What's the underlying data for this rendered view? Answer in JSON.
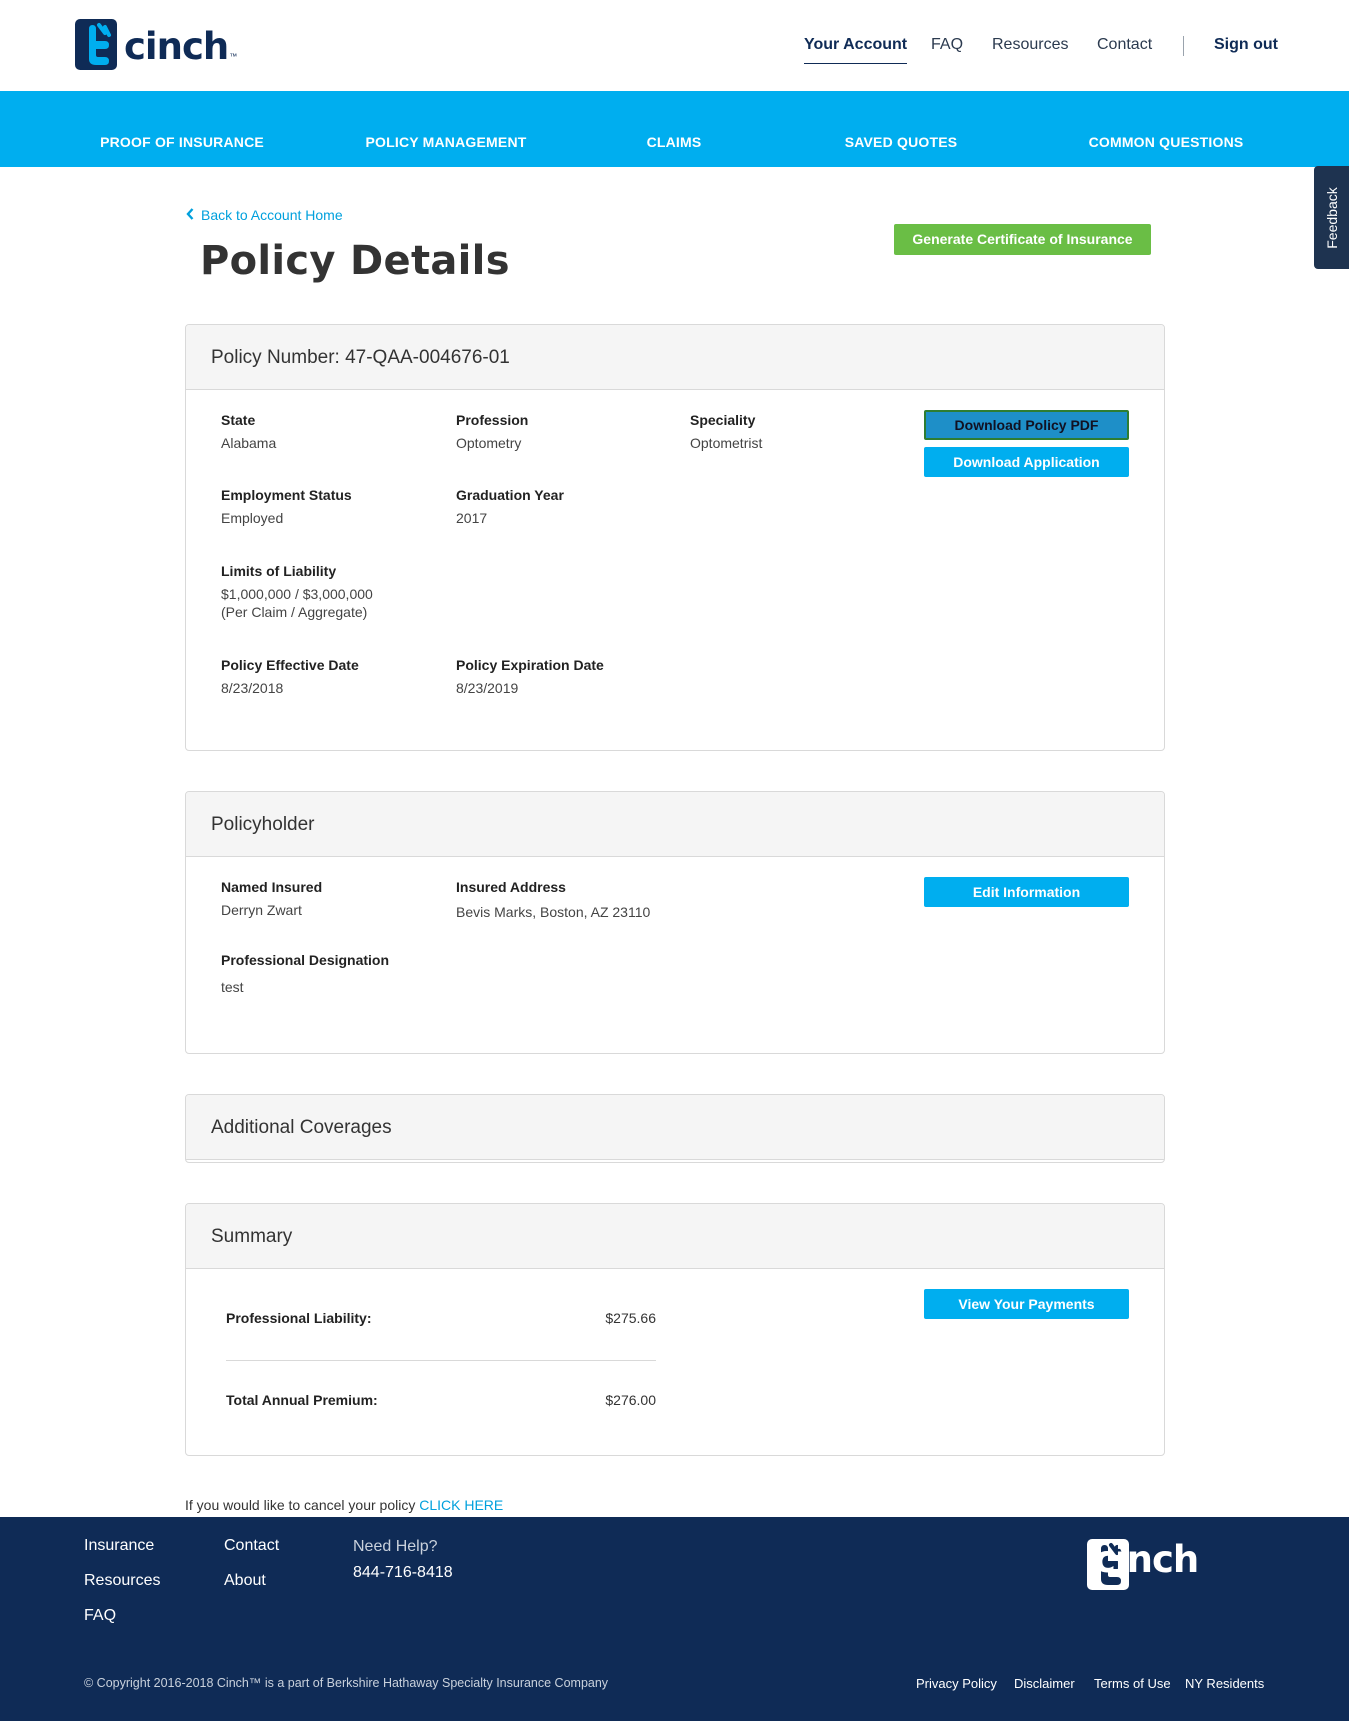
{
  "brand": {
    "name": "cinch",
    "tm": "™",
    "primary": "#0f2b56",
    "accent": "#00aeef",
    "green": "#6abe45"
  },
  "top_nav": {
    "your_account": "Your Account",
    "faq": "FAQ",
    "resources": "Resources",
    "contact": "Contact",
    "sign_out": "Sign out"
  },
  "sub_nav": [
    "PROOF OF INSURANCE",
    "POLICY MANAGEMENT",
    "CLAIMS",
    "SAVED QUOTES",
    "COMMON QUESTIONS"
  ],
  "feedback": "Feedback",
  "page": {
    "back_link": "Back to Account Home",
    "title": "Policy Details",
    "generate_certificate": "Generate Certificate of Insurance"
  },
  "policy": {
    "heading": "Policy Number: 47-QAA-004676-01",
    "state_label": "State",
    "state_value": "Alabama",
    "profession_label": "Profession",
    "profession_value": "Optometry",
    "speciality_label": "Speciality",
    "speciality_value": "Optometrist",
    "employment_label": "Employment Status",
    "employment_value": "Employed",
    "graduation_label": "Graduation Year",
    "graduation_value": "2017",
    "limits_label": "Limits of Liability",
    "limits_value": "$1,000,000 / $3,000,000",
    "limits_note": "(Per Claim / Aggregate)",
    "effective_label": "Policy Effective Date",
    "effective_value": "8/23/2018",
    "expiration_label": "Policy Expiration Date",
    "expiration_value": "8/23/2019",
    "download_pdf": "Download Policy PDF",
    "download_application": "Download Application"
  },
  "policyholder": {
    "heading": "Policyholder",
    "named_label": "Named Insured",
    "named_value": "Derryn Zwart",
    "address_label": "Insured Address",
    "address_value": "Bevis Marks, Boston, AZ 23110",
    "designation_label": "Professional Designation",
    "designation_value": "test",
    "edit_button": "Edit Information"
  },
  "additional_coverages": {
    "heading": "Additional Coverages"
  },
  "summary": {
    "heading": "Summary",
    "liability_label": "Professional Liability:",
    "liability_value": "$275.66",
    "total_label": "Total Annual Premium:",
    "total_value": "$276.00",
    "payments_button": "View Your Payments"
  },
  "cancel": {
    "text": "If you would like to cancel your policy",
    "link": "CLICK HERE"
  },
  "footer": {
    "links_col1": [
      "Insurance",
      "Resources",
      "FAQ"
    ],
    "links_col2": [
      "Contact",
      "About"
    ],
    "help_label": "Need Help?",
    "phone": "844-716-8418",
    "copyright": "© Copyright 2016-2018 Cinch™ is a part of Berkshire Hathaway Specialty Insurance Company",
    "legal": [
      "Privacy Policy",
      "Disclaimer",
      "Terms of Use",
      "NY Residents"
    ]
  }
}
